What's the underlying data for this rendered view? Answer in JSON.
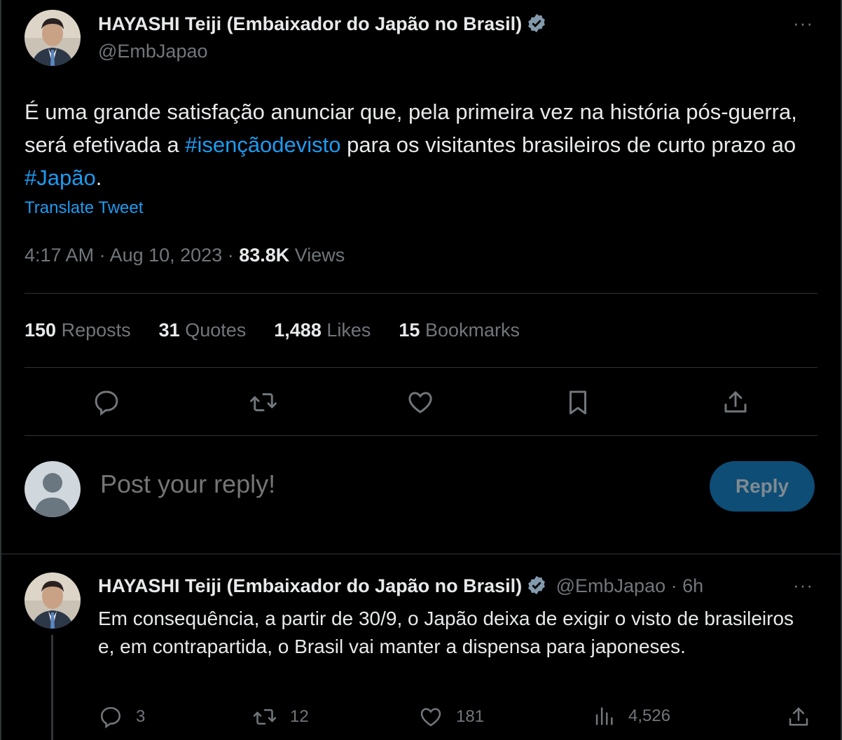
{
  "main_tweet": {
    "author_name": "HAYASHI Teiji (Embaixador do Japão no Brasil)",
    "handle": "@EmbJapao",
    "text_part1": "É uma grande satisfação anunciar que, pela primeira vez na história pós-guerra, será efetivada a ",
    "hashtag1": "#isençãodevisto",
    "text_part2": " para os visitantes brasileiros de curto prazo ao ",
    "hashtag2": "#Japão",
    "text_part3": ".",
    "translate_label": "Translate Tweet",
    "time": "4:17 AM · Aug 10, 2023 · ",
    "views_count": "83.8K",
    "views_label": " Views",
    "stats": {
      "reposts_count": "150",
      "reposts_label": "Reposts",
      "quotes_count": "31",
      "quotes_label": "Quotes",
      "likes_count": "1,488",
      "likes_label": "Likes",
      "bookmarks_count": "15",
      "bookmarks_label": "Bookmarks"
    },
    "more_label": "···"
  },
  "composer": {
    "placeholder": "Post your reply!",
    "reply_button": "Reply"
  },
  "reply_tweet": {
    "author_name": "HAYASHI Teiji (Embaixador do Japão no Brasil)",
    "handle_time": "@EmbJapao · 6h",
    "text": "Em consequência, a partir de 30/9, o Japão deixa de exigir o visto de brasileiros e, em contrapartida, o Brasil vai manter a dispensa para japoneses.",
    "replies": "3",
    "reposts": "12",
    "likes": "181",
    "views": "4,526",
    "more_label": "···"
  },
  "colors": {
    "background": "#000000",
    "accent": "#1d9bf0",
    "text": "#e7e9ea",
    "muted": "#71767b",
    "divider": "#2f3336"
  }
}
